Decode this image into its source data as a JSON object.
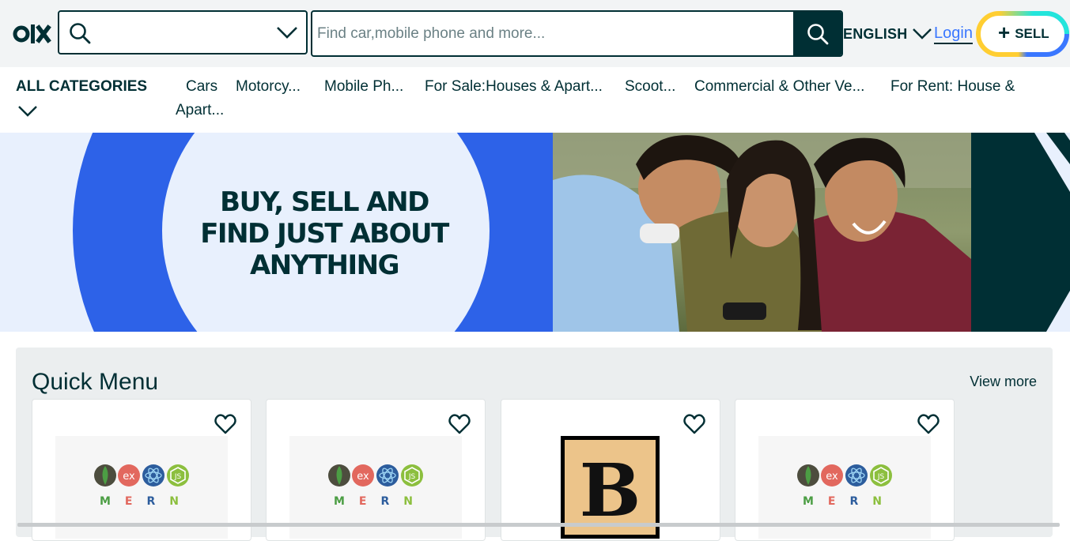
{
  "header": {
    "logo_text": "olx",
    "search": {
      "placeholder": "Find car,mobile phone and more...",
      "value": ""
    },
    "language": "ENGLISH",
    "login_label": "Login",
    "sell_label": "SELL",
    "sell_plus": "+"
  },
  "categories": {
    "all_label": "ALL CATEGORIES",
    "items": [
      "Cars",
      "Motorcy...",
      "Mobile Ph...",
      "For Sale:Houses & Apart...",
      "Scoot...",
      "Commercial & Other Ve...",
      "For Rent: House &",
      "Apart..."
    ]
  },
  "banner": {
    "line1": "BUY, SELL AND",
    "line2": "FIND JUST ABOUT",
    "line3": "ANYTHING"
  },
  "quick_menu": {
    "title": "Quick Menu",
    "view_more": "View more",
    "cards": [
      {
        "image": "mern-logo",
        "letters": [
          "M",
          "E",
          "R",
          "N"
        ]
      },
      {
        "image": "mern-logo",
        "letters": [
          "M",
          "E",
          "R",
          "N"
        ]
      },
      {
        "image": "b-logo",
        "letter": "B"
      },
      {
        "image": "mern-logo",
        "letters": [
          "M",
          "E",
          "R",
          "N"
        ]
      }
    ]
  },
  "colors": {
    "brand_dark": "#002f34",
    "banner_blue": "#2d62e8",
    "banner_light": "#e8f0fd",
    "login_blue": "#3a77ff",
    "sell_ring_yellow": "#ffce32",
    "sell_ring_blue": "#3a77ff",
    "sell_ring_teal": "#23e5db"
  },
  "icons": [
    "olx-logo",
    "search-icon",
    "chevron-down-icon",
    "heart-icon",
    "plus-icon"
  ]
}
